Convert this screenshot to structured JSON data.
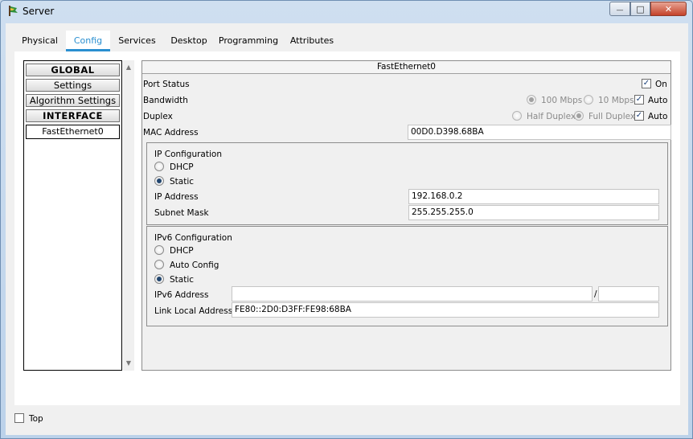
{
  "window": {
    "title": "Server",
    "min_glyph": "—",
    "max_glyph": "□",
    "close_glyph": "✕"
  },
  "tabs": [
    {
      "label": "Physical",
      "active": false
    },
    {
      "label": "Config",
      "active": true
    },
    {
      "label": "Services",
      "active": false
    },
    {
      "label": "Desktop",
      "active": false
    },
    {
      "label": "Programming",
      "active": false
    },
    {
      "label": "Attributes",
      "active": false
    }
  ],
  "sidebar": {
    "items": [
      {
        "label": "GLOBAL",
        "type": "header"
      },
      {
        "label": "Settings",
        "type": "item"
      },
      {
        "label": "Algorithm Settings",
        "type": "item"
      },
      {
        "label": "INTERFACE",
        "type": "header"
      },
      {
        "label": "FastEthernet0",
        "type": "item",
        "selected": true
      }
    ]
  },
  "interface": {
    "title": "FastEthernet0",
    "port_status_label": "Port Status",
    "port_on_label": "On",
    "port_on_checked": true,
    "bandwidth_label": "Bandwidth",
    "bw_100_label": "100 Mbps",
    "bw_10_label": "10 Mbps",
    "bw_auto_label": "Auto",
    "bw_auto_checked": true,
    "duplex_label": "Duplex",
    "half_duplex_label": "Half Duplex",
    "full_duplex_label": "Full Duplex",
    "duplex_auto_label": "Auto",
    "duplex_auto_checked": true,
    "mac_label": "MAC Address",
    "mac_value": "00D0.D398.68BA"
  },
  "ipv4": {
    "title": "IP Configuration",
    "dhcp_label": "DHCP",
    "static_label": "Static",
    "mode": "static",
    "ip_label": "IP Address",
    "ip_value": "192.168.0.2",
    "mask_label": "Subnet Mask",
    "mask_value": "255.255.255.0"
  },
  "ipv6": {
    "title": "IPv6 Configuration",
    "dhcp_label": "DHCP",
    "auto_label": "Auto Config",
    "static_label": "Static",
    "mode": "static",
    "address_label": "IPv6 Address",
    "address_value": "",
    "prefix_sep": "/",
    "prefix_value": "",
    "link_local_label": "Link Local Address:",
    "link_local_value": "FE80::2D0:D3FF:FE98:68BA"
  },
  "footer": {
    "top_label": "Top",
    "top_checked": false
  },
  "colors": {
    "accent": "#2a8fd0"
  }
}
